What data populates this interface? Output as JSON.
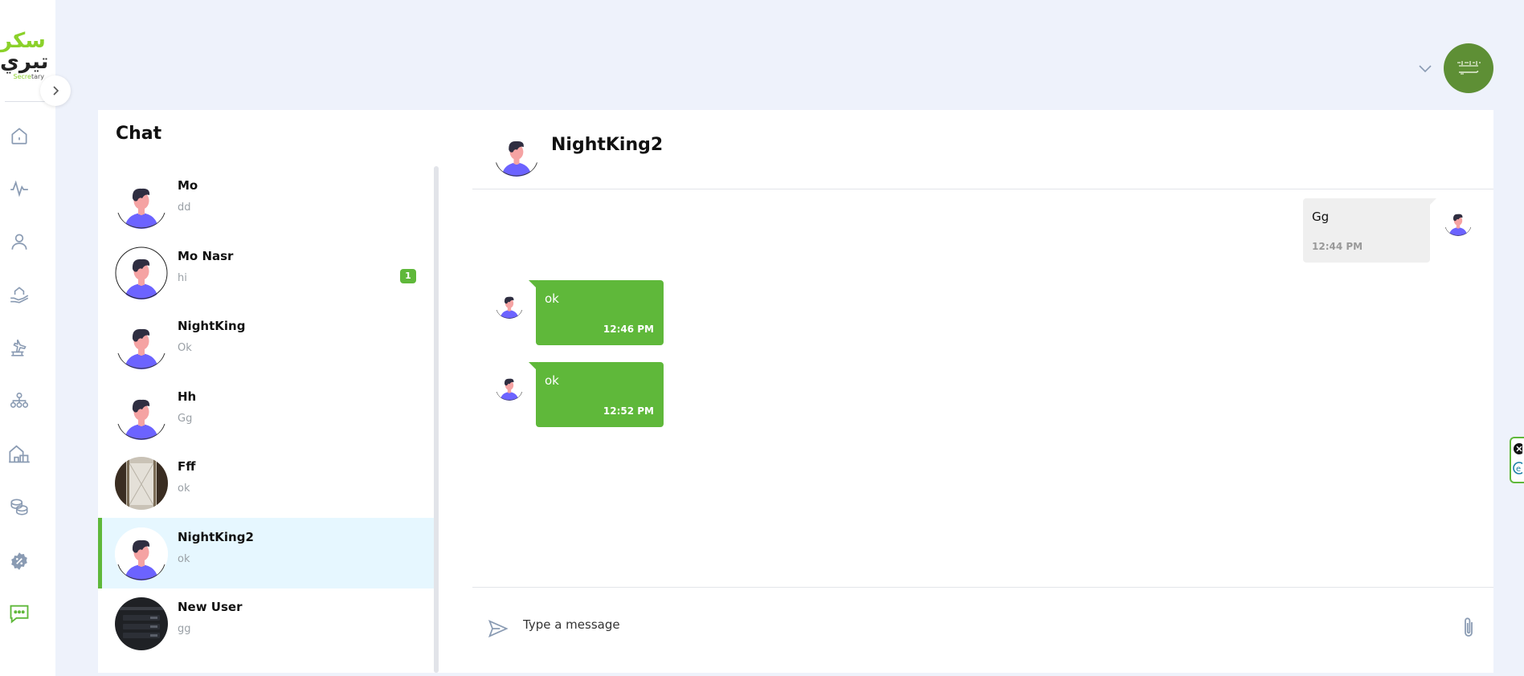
{
  "brand": {
    "logo_line1": "سكر",
    "logo_line2": "تيري",
    "logo_line3a": "Secre",
    "logo_line3b": "tary"
  },
  "chat": {
    "title": "Chat",
    "contacts": [
      {
        "name": "Mo",
        "last_message": "dd",
        "badge": ""
      },
      {
        "name": "Mo Nasr",
        "last_message": "hi",
        "badge": "1"
      },
      {
        "name": "NightKing",
        "last_message": "Ok",
        "badge": ""
      },
      {
        "name": "Hh",
        "last_message": "Gg",
        "badge": ""
      },
      {
        "name": "Fff",
        "last_message": "ok",
        "badge": ""
      },
      {
        "name": "NightKing2",
        "last_message": "ok",
        "badge": ""
      },
      {
        "name": "New User",
        "last_message": "gg",
        "badge": ""
      }
    ]
  },
  "conversation": {
    "name": "NightKing2",
    "messages": [
      {
        "direction": "outgoing",
        "text": "Gg",
        "time": "12:44 PM"
      },
      {
        "direction": "incoming",
        "text": "ok",
        "time": "12:46 PM"
      },
      {
        "direction": "incoming",
        "text": "ok",
        "time": "12:52 PM"
      }
    ]
  },
  "composer": {
    "placeholder": "Type a message"
  },
  "colors": {
    "accent": "#5fb83a",
    "active_item_bg": "#e6f7ff",
    "page_bg": "#eef2fb",
    "nav_icon": "#8a9bb3"
  }
}
